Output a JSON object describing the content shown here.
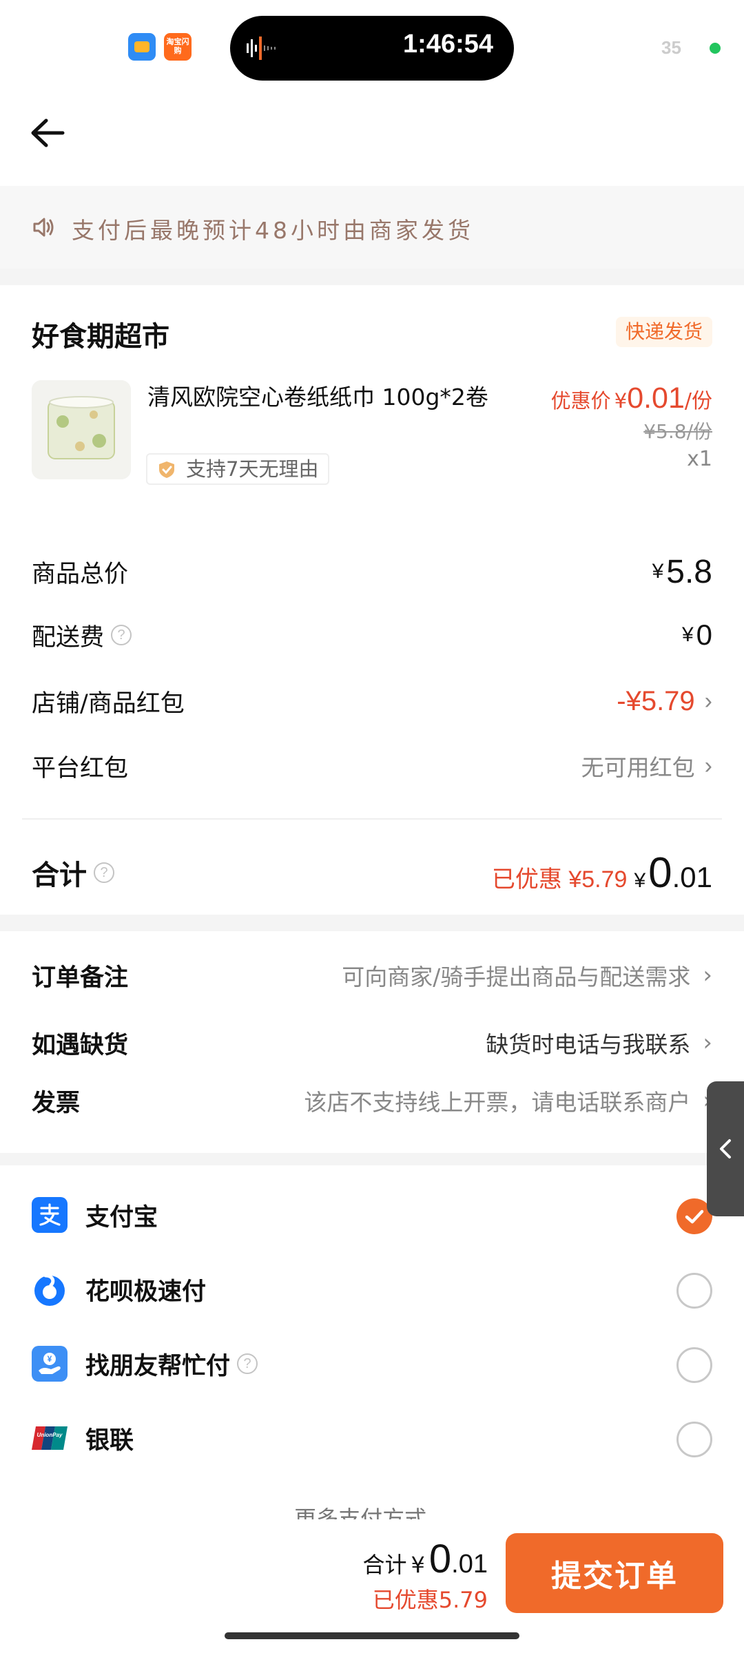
{
  "status_bar": {
    "time": "1:46:54",
    "app_badge_text": "淘宝闪购",
    "indicator_number": "35"
  },
  "notice": {
    "text": "支付后最晚预计48小时由商家发货"
  },
  "store": {
    "name": "好食期超市",
    "ship_tag": "快递发货",
    "product": {
      "title": "清风欧院空心卷纸纸巾 100g*2卷",
      "guarantee": "支持7天无理由",
      "promo_label": "优惠价",
      "currency": "¥",
      "promo_price": "0.01",
      "unit": "/份",
      "original_price": "¥5.8/份",
      "quantity": "x1"
    },
    "summary": {
      "goods_total_label": "商品总价",
      "goods_total_value": "5.8",
      "delivery_label": "配送费",
      "delivery_value": "0",
      "shop_coupon_label": "店铺/商品红包",
      "shop_coupon_value": "-¥5.79",
      "platform_coupon_label": "平台红包",
      "platform_coupon_value": "无可用红包",
      "total_label": "合计",
      "saved_text": "已优惠 ¥5.79",
      "total_int": "0",
      "total_dec": ".01"
    }
  },
  "notes": {
    "remark_label": "订单备注",
    "remark_value": "可向商家/骑手提出商品与配送需求",
    "stockout_label": "如遇缺货",
    "stockout_value": "缺货时电话与我联系",
    "invoice_label": "发票",
    "invoice_value": "该店不支持线上开票，请电话联系商户"
  },
  "payment": {
    "methods": [
      {
        "name": "支付宝",
        "selected": true,
        "color": "#1677ff"
      },
      {
        "name": "花呗极速付",
        "selected": false,
        "color": "#1677ff"
      },
      {
        "name": "找朋友帮忙付",
        "selected": false,
        "color": "#3d8ff5"
      },
      {
        "name": "银联",
        "selected": false,
        "color": "#d7282f"
      }
    ],
    "more_label": "更多支付方式"
  },
  "bottom_bar": {
    "sum_label": "合计",
    "currency": "¥",
    "sum_int": "0",
    "sum_dec": ".01",
    "saved_text": "已优惠5.79",
    "submit_label": "提交订单"
  },
  "colors": {
    "accent": "#f06a2a",
    "price_red": "#e5492e"
  }
}
